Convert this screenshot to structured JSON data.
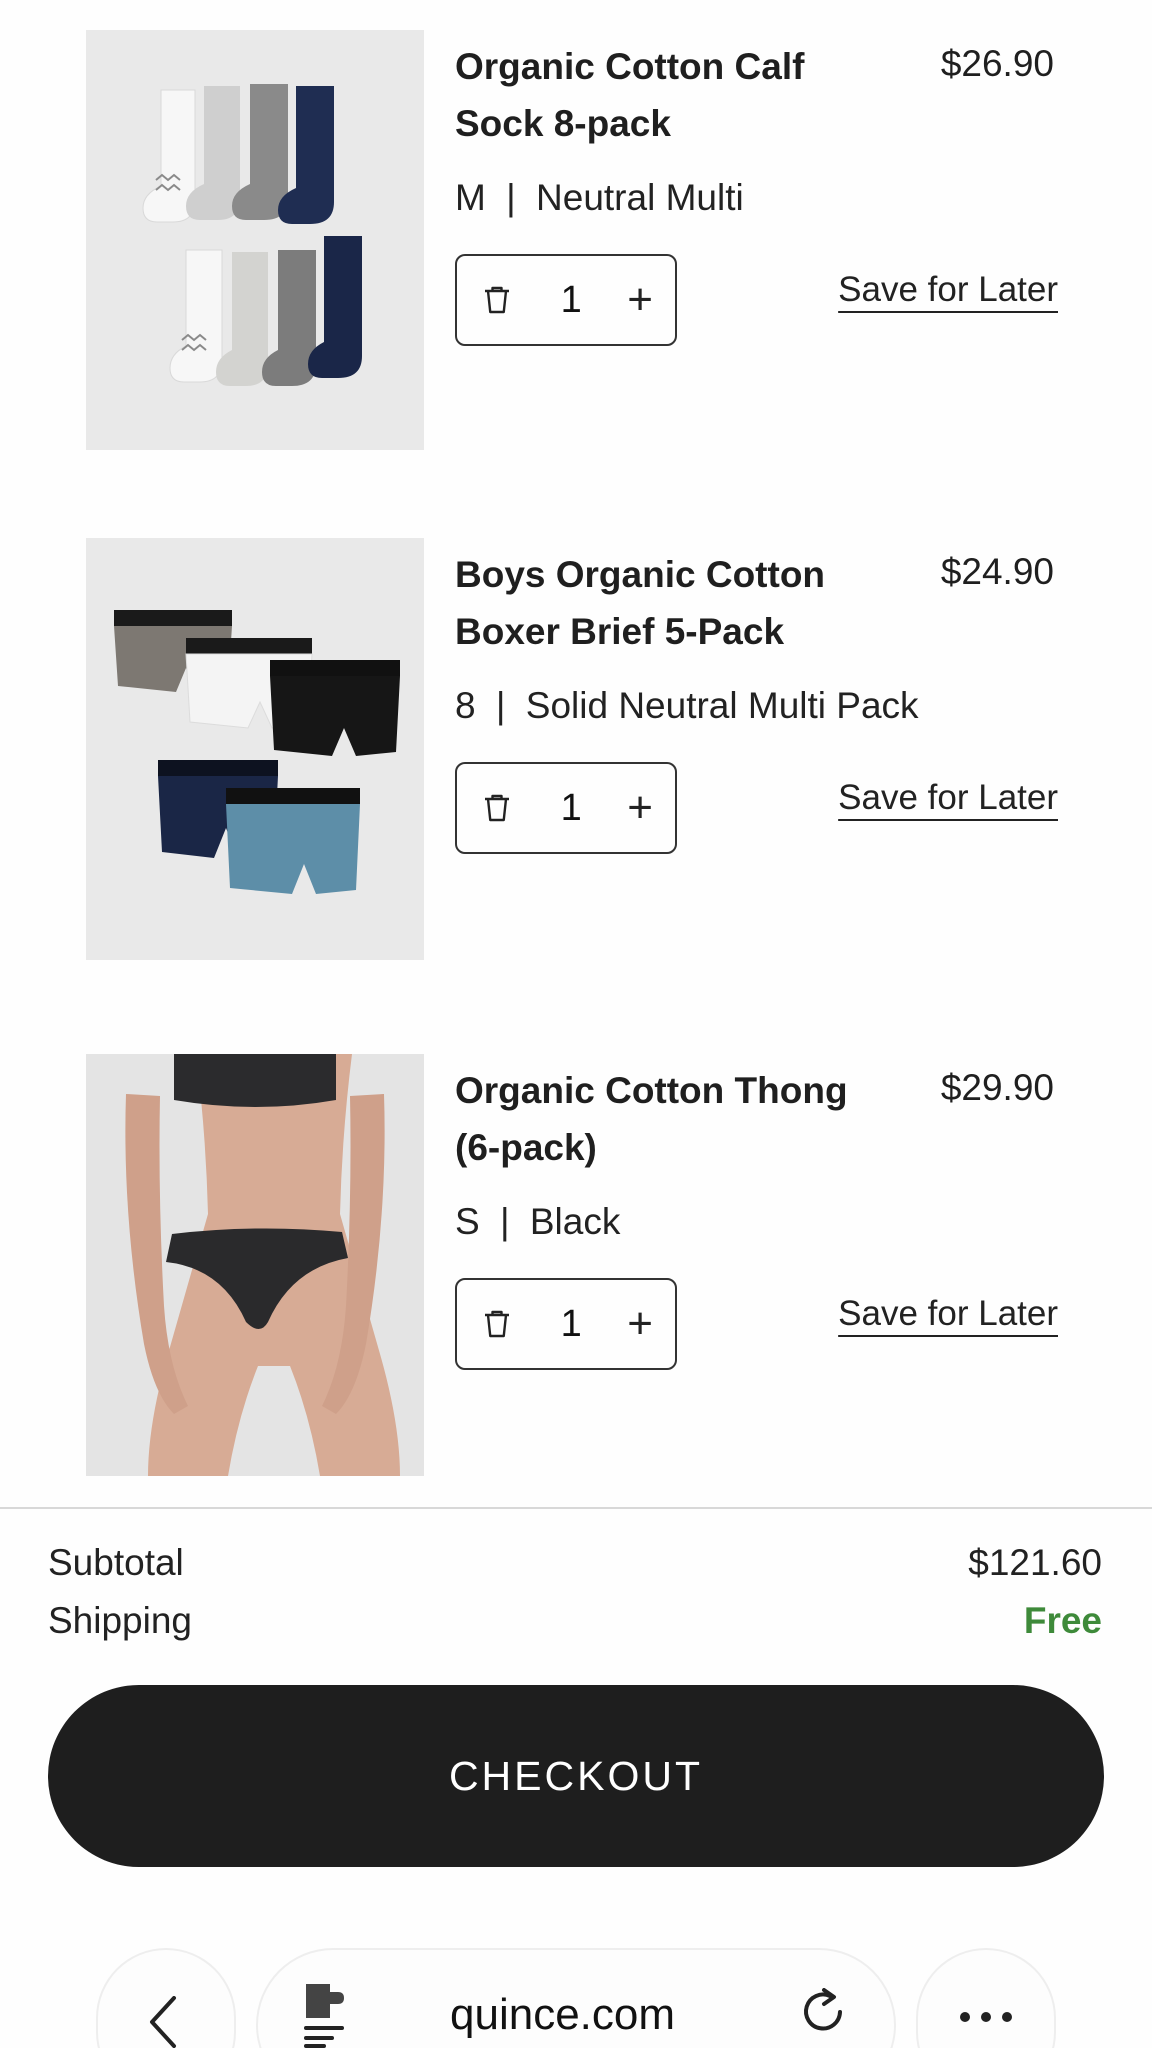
{
  "items": [
    {
      "name": "Organic Cotton Calf Sock 8-pack",
      "price": "$26.90",
      "size": "M",
      "color": "Neutral Multi",
      "qty": "1",
      "save_label": "Save for Later"
    },
    {
      "name": "Boys Organic Cotton Boxer Brief 5-Pack",
      "price": "$24.90",
      "size": "8",
      "color": "Solid Neutral Multi Pack",
      "qty": "1",
      "save_label": "Save for Later"
    },
    {
      "name": "Organic Cotton Thong (6-pack)",
      "price": "$29.90",
      "size": "S",
      "color": "Black",
      "qty": "1",
      "save_label": "Save for Later"
    }
  ],
  "variant_separator": "|",
  "summary": {
    "subtotal_label": "Subtotal",
    "subtotal_value": "$121.60",
    "shipping_label": "Shipping",
    "shipping_value": "Free"
  },
  "checkout_label": "CHECKOUT",
  "browser": {
    "url": "quince.com"
  },
  "colors": {
    "free": "#3e8a3a",
    "checkout_bg": "#1e1e1e"
  }
}
